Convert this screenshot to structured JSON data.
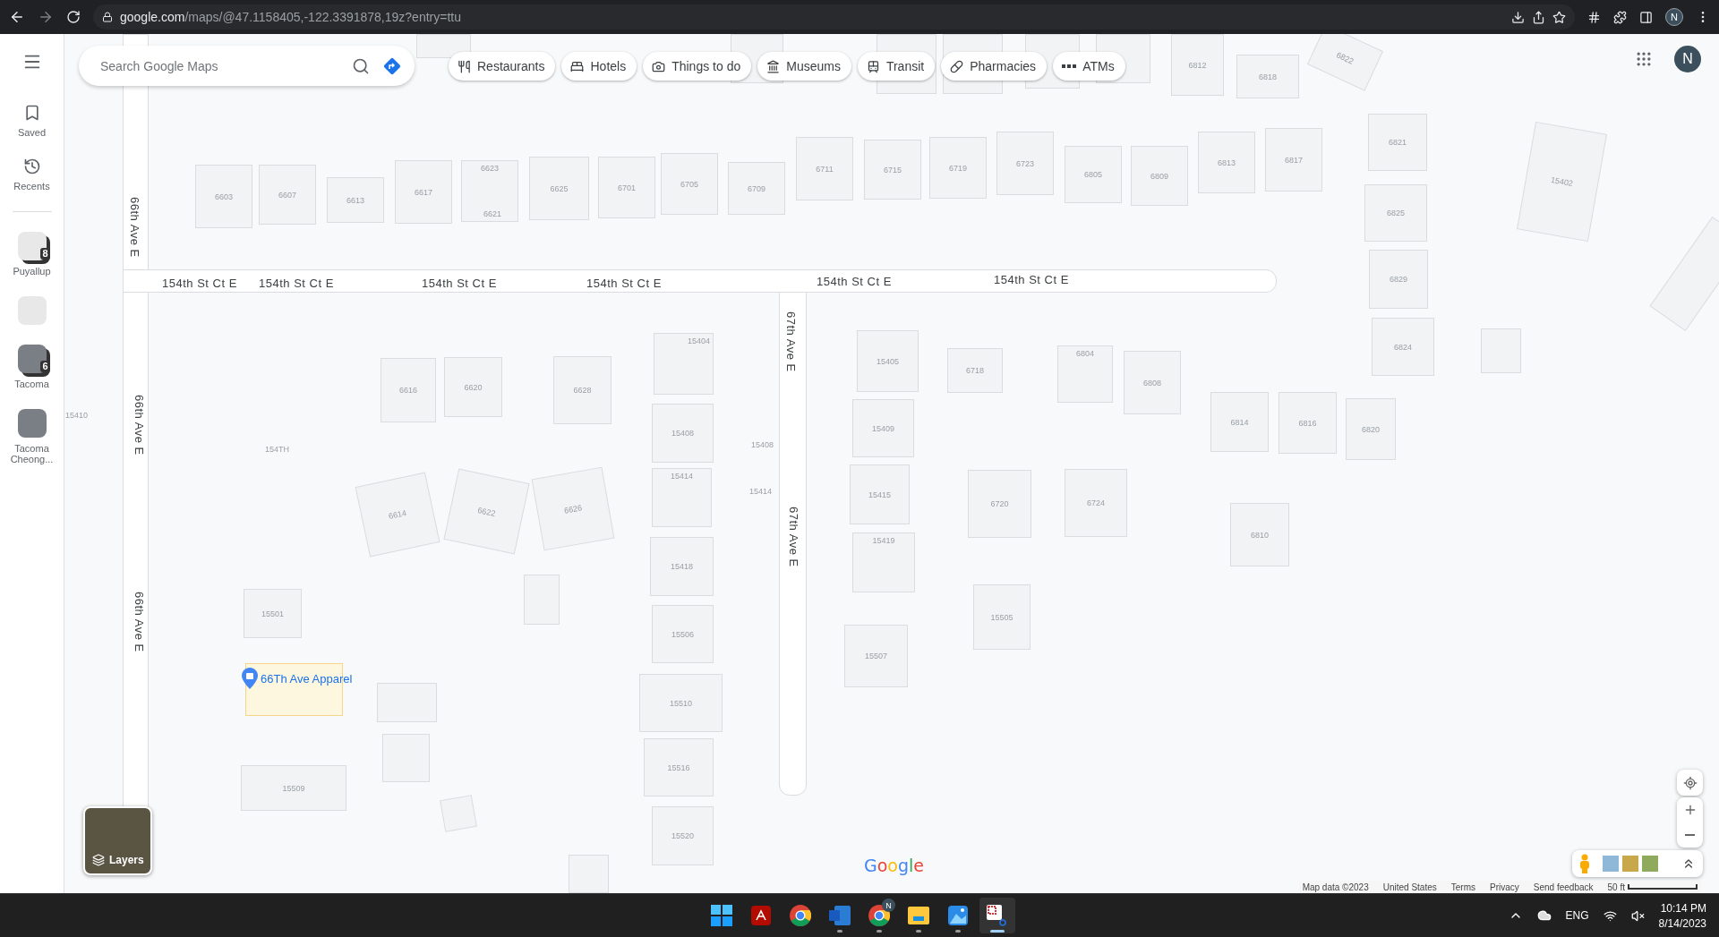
{
  "browser": {
    "url_host": "google.com",
    "url_path": "/maps/@47.1158405,-122.3391878,19z?entry=ttu",
    "profile": "N"
  },
  "sidebar": {
    "items": [
      {
        "kind": "menu"
      },
      {
        "kind": "saved",
        "label": "Saved"
      },
      {
        "kind": "recents",
        "label": "Recents"
      }
    ],
    "recent_places": [
      {
        "label": "Puyallup",
        "badge": "8",
        "kind": "building"
      },
      {
        "kind": "building"
      },
      {
        "label": "Tacoma",
        "badge": "6",
        "kind": "photo"
      },
      {
        "label": "Tacoma Cheong...",
        "kind": "photo"
      }
    ]
  },
  "search": {
    "placeholder": "Search Google Maps"
  },
  "categories": [
    {
      "label": "Restaurants",
      "kind": "restaurant"
    },
    {
      "label": "Hotels",
      "kind": "hotel"
    },
    {
      "label": "Things to do",
      "kind": "camera"
    },
    {
      "label": "Museums",
      "kind": "museum"
    },
    {
      "label": "Transit",
      "kind": "transit"
    },
    {
      "label": "Pharmacies",
      "kind": "pharmacy"
    },
    {
      "label": "ATMs",
      "kind": "atm"
    }
  ],
  "account": {
    "initial": "N"
  },
  "map": {
    "road_labels": [
      {
        "text": "66th Ave E",
        "vertical": true
      },
      {
        "text": "66th Ave E",
        "vertical": true
      },
      {
        "text": "66th Ave E",
        "vertical": true
      },
      {
        "text": "154th St Ct E",
        "vertical": false
      },
      {
        "text": "154th St Ct E",
        "vertical": false
      },
      {
        "text": "154th St Ct E",
        "vertical": false
      },
      {
        "text": "154th St Ct E",
        "vertical": false
      },
      {
        "text": "154th St Ct E",
        "vertical": false
      },
      {
        "text": "154th St Ct E",
        "vertical": false
      },
      {
        "text": "67th Ave E",
        "vertical": true
      },
      {
        "text": "67th Ave E",
        "vertical": true
      }
    ],
    "buildings": [
      "6603",
      "6607",
      "6613",
      "6617",
      "6623",
      "6625",
      "6701",
      "6705",
      "6709",
      "6711",
      "6715",
      "6719",
      "6723",
      "6805",
      "6809",
      "6813",
      "6817",
      "6821",
      "6825",
      "6829",
      "6824",
      "15402",
      "6812",
      "6818",
      "6822",
      "6616",
      "6620",
      "6628",
      "15404",
      "15408",
      "15414",
      "15418",
      "15506",
      "15510",
      "15516",
      "15520",
      "6614",
      "6622",
      "6626",
      "15501",
      "15509",
      "15405",
      "6718",
      "15409",
      "15415",
      "15419",
      "15507",
      "6720",
      "6724",
      "15505",
      "6804",
      "6808",
      "6814",
      "6816",
      "6820",
      "6810"
    ],
    "address_labels": [
      "6621",
      "15410",
      "154TH",
      "15408",
      "15414"
    ],
    "place": {
      "name": "66Th Ave Apparel",
      "highlighted": true
    },
    "logo": "Google"
  },
  "layers": {
    "label": "Layers"
  },
  "footer": {
    "links": [
      "Map data ©2023",
      "United States",
      "Terms",
      "Privacy",
      "Send feedback"
    ],
    "scale": "50 ft"
  },
  "taskbar": {
    "apps": [
      {
        "kind": "windows",
        "running": false,
        "selected": false
      },
      {
        "kind": "acrobat",
        "running": false,
        "selected": false
      },
      {
        "kind": "chrome",
        "running": false,
        "selected": false
      },
      {
        "kind": "word",
        "running": true,
        "selected": false
      },
      {
        "kind": "chrome-profile",
        "badge": "N",
        "running": true,
        "selected": false
      },
      {
        "kind": "explorer",
        "running": true,
        "selected": false
      },
      {
        "kind": "photos",
        "running": true,
        "selected": false
      },
      {
        "kind": "snipping",
        "running": true,
        "selected": true
      }
    ],
    "language": "ENG",
    "time": "10:14 PM",
    "date": "8/14/2023"
  }
}
